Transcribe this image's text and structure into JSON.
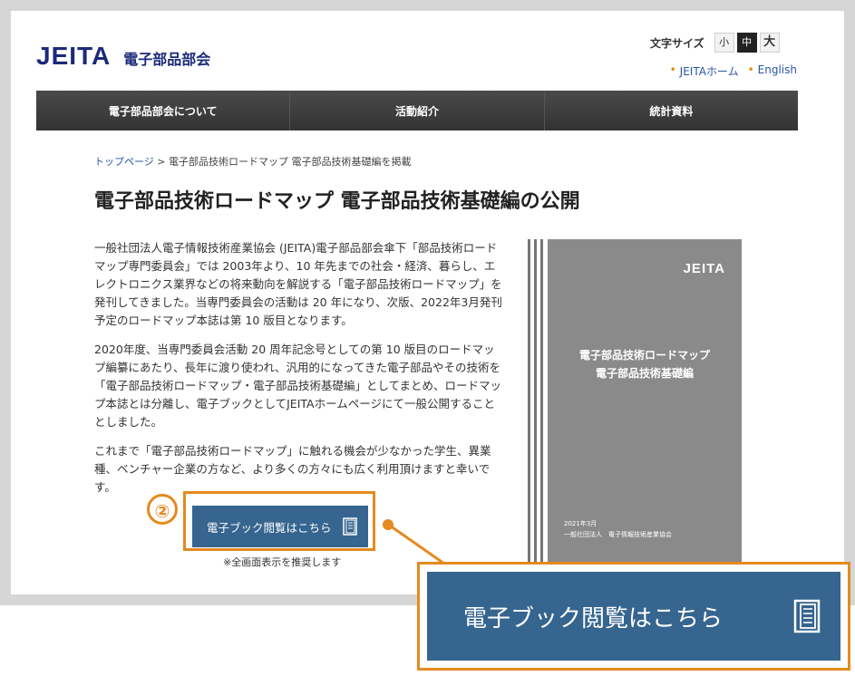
{
  "header": {
    "logo_text": "JEITA",
    "logo_sub": "電子部品部会",
    "font_size_label": "文字サイズ",
    "font_sizes": [
      "小",
      "中",
      "大"
    ],
    "links": [
      "JEITAホーム",
      "English"
    ]
  },
  "nav": {
    "items": [
      "電子部品部会について",
      "活動紹介",
      "統計資料"
    ]
  },
  "breadcrumb": {
    "home": "トップページ",
    "separator": ">",
    "current": "電子部品技術ロードマップ 電子部品技術基礎編を掲載"
  },
  "main": {
    "title": "電子部品技術ロードマップ 電子部品技術基礎編の公開",
    "paragraphs": [
      "一般社団法人電子情報技術産業協会 (JEITA)電子部品部会傘下「部品技術ロードマップ専門委員会」では 2003年より、10 年先までの社会・経済、暮らし、エレクトロニクス業界などの将来動向を解説する「電子部品技術ロードマップ」を発刊してきました。当専門委員会の活動は 20 年になり、次版、2022年3月発刊予定のロードマップ本誌は第 10 版目となります。",
      "2020年度、当専門委員会活動 20 周年記念号としての第 10 版目のロードマップ編纂にあたり、長年に渡り使われ、汎用的になってきた電子部品やその技術を「電子部品技術ロードマップ・電子部品技術基礎編」としてまとめ、ロードマップ本誌とは分離し、電子ブックとしてJEITAホームページにて一般公開することとしました。",
      "これまで「電子部品技術ロードマップ」に触れる機会が少なかった学生、異業種、ベンチャー企業の方など、より多くの方々にも広く利用頂けますと幸いです。"
    ],
    "ebook_button": "電子ブック閲覧はこちら",
    "note": "※全画面表示を推奨します"
  },
  "cover": {
    "brand": "JEITA",
    "title_line1": "電子部品技術ロードマップ",
    "title_line2": "電子部品技術基礎編",
    "date": "2021年3月",
    "publisher": "一般社団法人　電子情報技術産業協会"
  },
  "callout": {
    "number": "②",
    "zoom_label": "電子ブック閲覧はこちら"
  },
  "colors": {
    "accent": "#e58a1f",
    "button": "#36658f",
    "brand": "#1a2a7a"
  }
}
